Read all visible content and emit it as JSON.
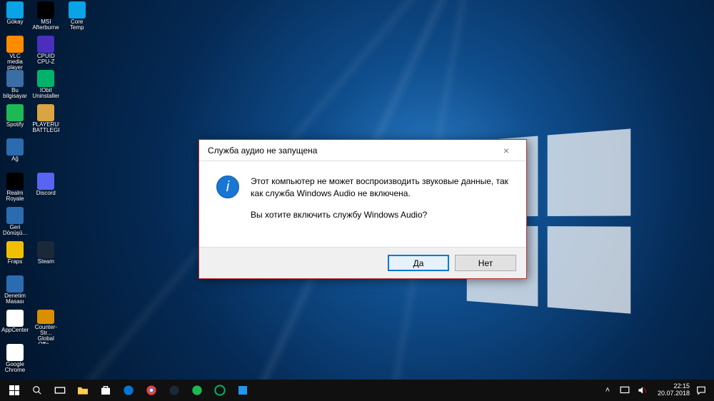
{
  "desktop_icons": [
    {
      "label": "Gökay",
      "color": "#0aa3e8"
    },
    {
      "label": "VLC media player",
      "color": "#ff8c00"
    },
    {
      "label": "Bu bilgisayar",
      "color": "#3a6ea5"
    },
    {
      "label": "Spotify",
      "color": "#1db954"
    },
    {
      "label": "Ağ",
      "color": "#2b6cb0"
    },
    {
      "label": "Realm Royale",
      "color": "#000000"
    },
    {
      "label": "Geri Dönüşü...",
      "color": "#2b6cb0"
    },
    {
      "label": "Fraps",
      "color": "#f0c000"
    },
    {
      "label": "Denetim Masası",
      "color": "#2b6cb0"
    },
    {
      "label": "AppCenter",
      "color": "#ffffff"
    },
    {
      "label": "Google Chrome",
      "color": "#ffffff"
    },
    {
      "label": "MSI Afterburner",
      "color": "#000000"
    },
    {
      "label": "CPUID CPU-Z",
      "color": "#4a2fbd"
    },
    {
      "label": "IObit Uninstaller",
      "color": "#00b36b"
    },
    {
      "label": "PLAYERUN... BATTLEGR...",
      "color": "#d9a441"
    },
    {
      "label": "",
      "color": ""
    },
    {
      "label": "Discord",
      "color": "#5865f2"
    },
    {
      "label": "",
      "color": ""
    },
    {
      "label": "Steam",
      "color": "#1b2838"
    },
    {
      "label": "",
      "color": ""
    },
    {
      "label": "Counter-Str... Global Offe...",
      "color": "#d98f00"
    },
    {
      "label": "",
      "color": ""
    },
    {
      "label": "Core Temp",
      "color": "#0aa3e8"
    }
  ],
  "dialog": {
    "title": "Служба аудио не запущена",
    "line1": "Этот компьютер не может воспроизводить звуковые данные, так как служба Windows Audio не включена.",
    "line2": "Вы хотите включить службу Windows Audio?",
    "yes": "Да",
    "no": "Нет",
    "close": "×",
    "info_glyph": "i"
  },
  "taskbar": {
    "items": [
      "start",
      "search",
      "taskview",
      "explorer",
      "store",
      "edge",
      "chrome",
      "steam",
      "spotify",
      "iobit",
      "settings"
    ],
    "time": "22:15",
    "date": "20.07.2018",
    "tray_expand": "˄"
  }
}
